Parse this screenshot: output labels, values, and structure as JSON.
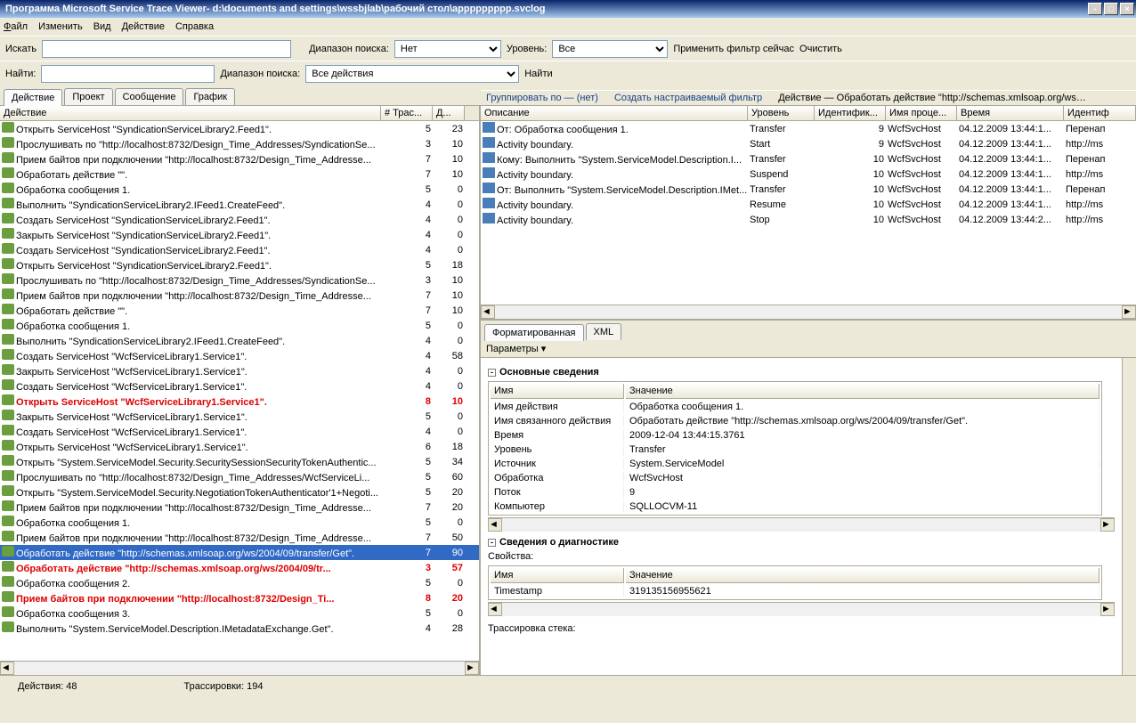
{
  "title": "Программа Microsoft Service Trace Viewer- d:\\documents and settings\\wssbjlab\\рабочий стол\\appppppppp.svclog",
  "menu": {
    "file": "Файл",
    "edit": "Изменить",
    "view": "Вид",
    "activity": "Действие",
    "help": "Справка"
  },
  "tb1": {
    "search": "Искать",
    "range": "Диапазон поиска:",
    "rangeVal": "Нет",
    "level": "Уровень:",
    "levelVal": "Все",
    "apply": "Применить фильтр сейчас",
    "clear": "Очистить"
  },
  "tb2": {
    "find": "Найти:",
    "range": "Диапазон поиска:",
    "rangeVal": "Все действия",
    "findBtn": "Найти"
  },
  "tabs": {
    "activity": "Действие",
    "project": "Проект",
    "message": "Сообщение",
    "graph": "График"
  },
  "cbar": {
    "group": "Группировать по — (нет)",
    "filter": "Создать настраиваемый фильтр",
    "path": "Действие — Обработать действие \"http://schemas.xmlsoap.org/ws…"
  },
  "leftCols": {
    "c1": "Действие",
    "c2": "# Трас...",
    "c3": "Д..."
  },
  "leftRows": [
    {
      "t": "Открыть ServiceHost \"SyndicationServiceLibrary2.Feed1\".",
      "n": "5",
      "d": "23"
    },
    {
      "t": "Прослушивать по \"http://localhost:8732/Design_Time_Addresses/SyndicationSe...",
      "n": "3",
      "d": "10"
    },
    {
      "t": "Прием байтов при подключении \"http://localhost:8732/Design_Time_Addresse...",
      "n": "7",
      "d": "10"
    },
    {
      "t": "Обработать действие \"\".",
      "n": "7",
      "d": "10"
    },
    {
      "t": "Обработка сообщения 1.",
      "n": "5",
      "d": "0"
    },
    {
      "t": "Выполнить \"SyndicationServiceLibrary2.IFeed1.CreateFeed\".",
      "n": "4",
      "d": "0"
    },
    {
      "t": "Создать ServiceHost \"SyndicationServiceLibrary2.Feed1\".",
      "n": "4",
      "d": "0"
    },
    {
      "t": "Закрыть ServiceHost \"SyndicationServiceLibrary2.Feed1\".",
      "n": "4",
      "d": "0"
    },
    {
      "t": "Создать ServiceHost \"SyndicationServiceLibrary2.Feed1\".",
      "n": "4",
      "d": "0"
    },
    {
      "t": "Открыть ServiceHost \"SyndicationServiceLibrary2.Feed1\".",
      "n": "5",
      "d": "18"
    },
    {
      "t": "Прослушивать по \"http://localhost:8732/Design_Time_Addresses/SyndicationSe...",
      "n": "3",
      "d": "10"
    },
    {
      "t": "Прием байтов при подключении \"http://localhost:8732/Design_Time_Addresse...",
      "n": "7",
      "d": "10"
    },
    {
      "t": "Обработать действие \"\".",
      "n": "7",
      "d": "10"
    },
    {
      "t": "Обработка сообщения 1.",
      "n": "5",
      "d": "0"
    },
    {
      "t": "Выполнить \"SyndicationServiceLibrary2.IFeed1.CreateFeed\".",
      "n": "4",
      "d": "0"
    },
    {
      "t": "Создать ServiceHost \"WcfServiceLibrary1.Service1\".",
      "n": "4",
      "d": "58"
    },
    {
      "t": "Закрыть ServiceHost \"WcfServiceLibrary1.Service1\".",
      "n": "4",
      "d": "0"
    },
    {
      "t": "Создать ServiceHost \"WcfServiceLibrary1.Service1\".",
      "n": "4",
      "d": "0"
    },
    {
      "t": "Открыть ServiceHost \"WcfServiceLibrary1.Service1\".",
      "n": "8",
      "d": "10",
      "err": true
    },
    {
      "t": "Закрыть ServiceHost \"WcfServiceLibrary1.Service1\".",
      "n": "5",
      "d": "0"
    },
    {
      "t": "Создать ServiceHost \"WcfServiceLibrary1.Service1\".",
      "n": "4",
      "d": "0"
    },
    {
      "t": "Открыть ServiceHost \"WcfServiceLibrary1.Service1\".",
      "n": "6",
      "d": "18"
    },
    {
      "t": "Открыть \"System.ServiceModel.Security.SecuritySessionSecurityTokenAuthentic...",
      "n": "5",
      "d": "34"
    },
    {
      "t": "Прослушивать по \"http://localhost:8732/Design_Time_Addresses/WcfServiceLi...",
      "n": "5",
      "d": "60"
    },
    {
      "t": "Открыть \"System.ServiceModel.Security.NegotiationTokenAuthenticator'1+Negoti...",
      "n": "5",
      "d": "20"
    },
    {
      "t": "Прием байтов при подключении \"http://localhost:8732/Design_Time_Addresse...",
      "n": "7",
      "d": "20"
    },
    {
      "t": "Обработка сообщения 1.",
      "n": "5",
      "d": "0"
    },
    {
      "t": "Прием байтов при подключении \"http://localhost:8732/Design_Time_Addresse...",
      "n": "7",
      "d": "50"
    },
    {
      "t": "Обработать действие \"http://schemas.xmlsoap.org/ws/2004/09/transfer/Get\".",
      "n": "7",
      "d": "90",
      "sel": true
    },
    {
      "t": "Обработать действие \"http://schemas.xmlsoap.org/ws/2004/09/tr...",
      "n": "3",
      "d": "57",
      "err": true
    },
    {
      "t": "Обработка сообщения 2.",
      "n": "5",
      "d": "0"
    },
    {
      "t": "Прием байтов при подключении \"http://localhost:8732/Design_Ti...",
      "n": "8",
      "d": "20",
      "err": true
    },
    {
      "t": "Обработка сообщения 3.",
      "n": "5",
      "d": "0"
    },
    {
      "t": "Выполнить \"System.ServiceModel.Description.IMetadataExchange.Get\".",
      "n": "4",
      "d": "28"
    }
  ],
  "rightCols": {
    "c1": "Описание",
    "c2": "Уровень",
    "c3": "Идентифик...",
    "c4": "Имя проце...",
    "c5": "Время",
    "c6": "Идентиф"
  },
  "rightRows": [
    {
      "d": "От: Обработка сообщения 1.",
      "l": "Transfer",
      "i": "9",
      "p": "WcfSvcHost",
      "t": "04.12.2009 13:44:1...",
      "x": "Перенап"
    },
    {
      "d": "Activity boundary.",
      "l": "Start",
      "i": "9",
      "p": "WcfSvcHost",
      "t": "04.12.2009 13:44:1...",
      "x": "http://ms"
    },
    {
      "d": "Кому: Выполнить \"System.ServiceModel.Description.I...",
      "l": "Transfer",
      "i": "10",
      "p": "WcfSvcHost",
      "t": "04.12.2009 13:44:1...",
      "x": "Перенап"
    },
    {
      "d": "Activity boundary.",
      "l": "Suspend",
      "i": "10",
      "p": "WcfSvcHost",
      "t": "04.12.2009 13:44:1...",
      "x": "http://ms"
    },
    {
      "d": "От: Выполнить \"System.ServiceModel.Description.IMet...",
      "l": "Transfer",
      "i": "10",
      "p": "WcfSvcHost",
      "t": "04.12.2009 13:44:1...",
      "x": "Перенап"
    },
    {
      "d": "Activity boundary.",
      "l": "Resume",
      "i": "10",
      "p": "WcfSvcHost",
      "t": "04.12.2009 13:44:1...",
      "x": "http://ms"
    },
    {
      "d": "Activity boundary.",
      "l": "Stop",
      "i": "10",
      "p": "WcfSvcHost",
      "t": "04.12.2009 13:44:2...",
      "x": "http://ms"
    }
  ],
  "rtabs": {
    "fmt": "Форматированная",
    "xml": "XML"
  },
  "params": "Параметры ▾",
  "sect1": {
    "h": "Основные сведения",
    "nameH": "Имя",
    "valH": "Значение",
    "rows": [
      [
        "Имя действия",
        "Обработка сообщения 1."
      ],
      [
        "Имя связанного действия",
        "Обработать действие \"http://schemas.xmlsoap.org/ws/2004/09/transfer/Get\"."
      ],
      [
        "Время",
        "2009-12-04 13:44:15.3761"
      ],
      [
        "Уровень",
        "Transfer"
      ],
      [
        "Источник",
        "System.ServiceModel"
      ],
      [
        "Обработка",
        "WcfSvcHost"
      ],
      [
        "Поток",
        "9"
      ],
      [
        "Компьютер",
        "SQLLOCVM-11"
      ]
    ]
  },
  "sect2": {
    "h": "Сведения о диагностике",
    "props": "Свойства:",
    "nameH": "Имя",
    "valH": "Значение",
    "rows": [
      [
        "Timestamp",
        "319135156955621"
      ]
    ],
    "stack": "Трассировка стека:"
  },
  "status": {
    "a": "Действия: 48",
    "t": "Трассировки: 194"
  }
}
